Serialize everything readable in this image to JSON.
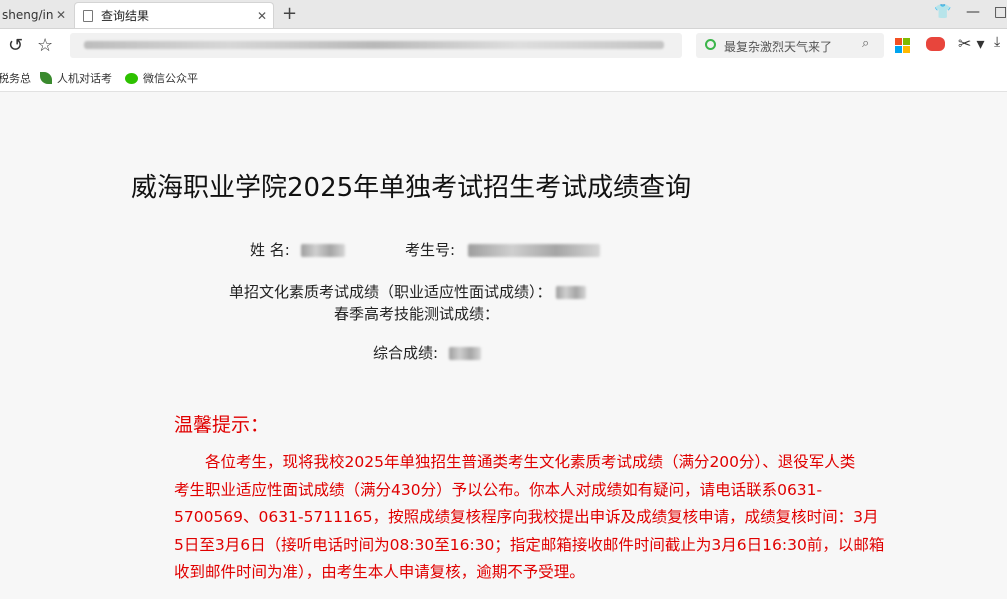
{
  "browser": {
    "tabs": [
      {
        "label": "sheng/inc",
        "active": false
      },
      {
        "label": "查询结果",
        "active": true
      }
    ],
    "search_placeholder": "最复杂激烈天气来了",
    "bookmarks": [
      {
        "label": "税务总"
      },
      {
        "label": "人机对话考"
      },
      {
        "label": "微信公众平"
      }
    ]
  },
  "page": {
    "title": "威海职业学院2025年单独考试招生考试成绩查询",
    "name_label": "姓  名:",
    "exam_no_label": "考生号:",
    "culture_score_label": "单招文化素质考试成绩（职业适应性面试成绩）：",
    "skill_score_label": "春季高考技能测试成绩：",
    "total_score_label": "综合成绩:"
  },
  "notice": {
    "title": "温馨提示：",
    "lines": [
      "　　各位考生，现将我校2025年单独招生普通类考生文化素质考试成绩（满分200分）、退役军人类",
      "考生职业适应性面试成绩（满分430分）予以公布。你本人对成绩如有疑问，请电话联系0631-",
      "5700569、0631-5711165，按照成绩复核程序向我校提出申诉及成绩复核申请，成绩复核时间：3月",
      "5日至3月6日（接听电话时间为08:30至16:30；指定邮箱接收邮件时间截止为3月6日16:30前，以邮箱",
      "收到邮件时间为准），由考生本人申请复核，逾期不予受理。"
    ]
  },
  "colors": {
    "notice_red": "#e00000",
    "page_bg": "#f7f7f7"
  }
}
